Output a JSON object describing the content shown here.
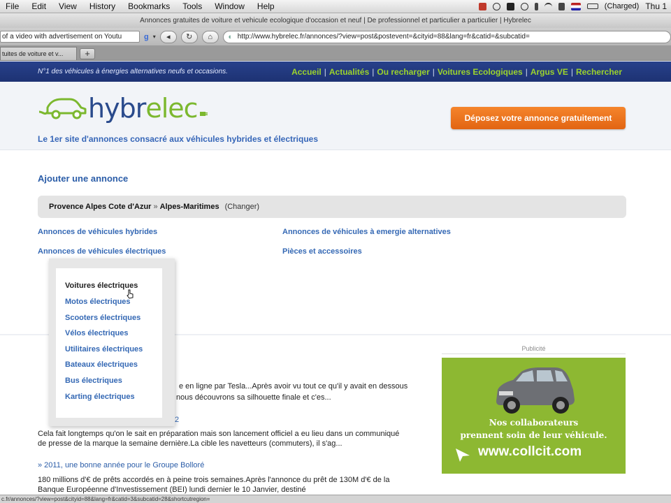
{
  "menubar": {
    "items": [
      "File",
      "Edit",
      "View",
      "History",
      "Bookmarks",
      "Tools",
      "Window",
      "Help"
    ],
    "status_text": "(Charged)",
    "clock": "Thu 1"
  },
  "window": {
    "title": "Annonces gratuites de voiture et vehicule ecologique d'occasion et neuf | De professionnel et particulier a particulier | Hybrelec"
  },
  "toolbar": {
    "search_value": "of a video with advertisement on Youtu",
    "back_icon": "back-arrow-icon",
    "reload_icon": "reload-icon",
    "home_icon": "home-icon",
    "url": "http://www.hybrelec.fr/annonces/?view=post&postevent=&cityid=88&lang=fr&catid=&subcatid="
  },
  "tabs": [
    {
      "label": "tuites de voiture et v..."
    }
  ],
  "sitenav": {
    "tagline": "N°1 des véhicules à énergies alternatives neufs et occasions.",
    "links": [
      "Accueil",
      "Actualités",
      "Ou recharger",
      "Voitures Ecologiques",
      "Argus VE",
      "Rechercher"
    ],
    "separator": "|"
  },
  "header": {
    "logo_part1": "hybr",
    "logo_part2": "elec",
    "slogan": "Le 1er site d'annonces consacré aux véhicules hybrides et électriques",
    "cta_label": "Déposez votre annonce gratuitement"
  },
  "main": {
    "add_title": "Ajouter une annonce",
    "location": {
      "region": "Provence Alpes Cote d'Azur",
      "separator": "»",
      "department": "Alpes-Maritimes",
      "change_label": "(Changer)"
    },
    "categories": [
      "Annonces de véhicules hybrides",
      "Annonces de véhicules à emergie alternatives",
      "Annonces de véhicules électriques",
      "Pièces et accessoires"
    ]
  },
  "dropdown": {
    "items": [
      "Voitures électriques",
      "Motos électriques",
      "Scooters électriques",
      "Vélos électriques",
      "Utilitaires électriques",
      "Bateaux électriques",
      "Bus électriques",
      "Karting électriques"
    ]
  },
  "articles": {
    "frag1_line1": "e en ligne par Tesla...Après avoir vu tout ce qu'il y avait en dessous",
    "frag1_line2": "nous découvrons sa silhouette finale et c'es...",
    "frag2_title": "2",
    "article2_line1": "Cela fait longtemps qu'on le sait en préparation mais son lancement officiel a eu lieu dans un communiqué",
    "article2_line2": "de presse de la marque la semaine dernière.La cible les navetteurs (commuters), il s'ag...",
    "article3_title": "» 2011, une bonne année pour le Groupe Bolloré",
    "article3_line1": "180 millions d'€ de prêts accordés en à peine trois semaines.Après l'annonce du prêt de 130M d'€ de la",
    "article3_line2": "Banque Européenne d'Investissement (BEI) lundi dernier le 10 Janvier, destiné"
  },
  "ad": {
    "label": "Publicité",
    "line1": "Nos collaborateurs",
    "line2": "prennent soin de leur véhicule.",
    "url": "www.collcit.com",
    "bg_color": "#8db832"
  },
  "statusbar": {
    "text": "c.fr/annonces/?view=post&cityid=88&lang=fr&catid=3&subcatid=28&shortcutregion="
  }
}
